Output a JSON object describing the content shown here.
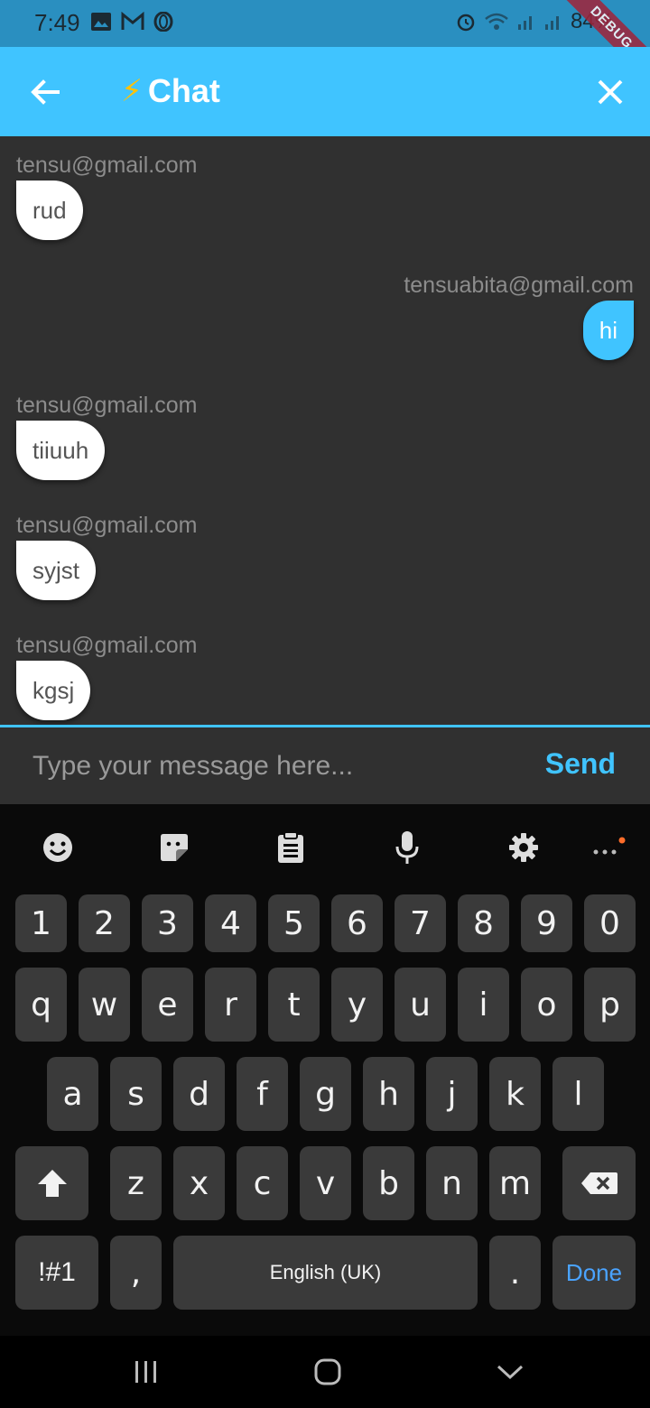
{
  "status_bar": {
    "time": "7:49",
    "battery": "84%"
  },
  "debug_label": "DEBUG",
  "app_bar": {
    "title": "Chat",
    "title_emoji": "⚡"
  },
  "messages": [
    {
      "sender": "tensu@gmail.com",
      "text": "rud",
      "direction": "incoming"
    },
    {
      "sender": "tensuabita@gmail.com",
      "text": "hi",
      "direction": "outgoing"
    },
    {
      "sender": "tensu@gmail.com",
      "text": "tiiuuh",
      "direction": "incoming"
    },
    {
      "sender": "tensu@gmail.com",
      "text": "syjst",
      "direction": "incoming"
    },
    {
      "sender": "tensu@gmail.com",
      "text": "kgsj",
      "direction": "incoming"
    }
  ],
  "composer": {
    "placeholder": "Type your message here...",
    "value": "",
    "send_label": "Send"
  },
  "keyboard": {
    "toolbar_icons": [
      "emoji-icon",
      "sticker-icon",
      "clipboard-icon",
      "microphone-icon",
      "settings-icon",
      "more-icon"
    ],
    "row_numbers": [
      "1",
      "2",
      "3",
      "4",
      "5",
      "6",
      "7",
      "8",
      "9",
      "0"
    ],
    "row_top": [
      "q",
      "w",
      "e",
      "r",
      "t",
      "y",
      "u",
      "i",
      "o",
      "p"
    ],
    "row_middle": [
      "a",
      "s",
      "d",
      "f",
      "g",
      "h",
      "j",
      "k",
      "l"
    ],
    "row_bottom": [
      "z",
      "x",
      "c",
      "v",
      "b",
      "n",
      "m"
    ],
    "symbols_label": "!#1",
    "comma_label": ",",
    "space_label": "English (UK)",
    "period_label": ".",
    "done_label": "Done"
  },
  "colors": {
    "accent": "#40c4ff",
    "status_bar": "#2a8fc0",
    "chat_bg": "#303030",
    "keyboard_bg": "#0a0a0a",
    "key_bg": "#3a3a3a",
    "done": "#4aa3ff"
  }
}
